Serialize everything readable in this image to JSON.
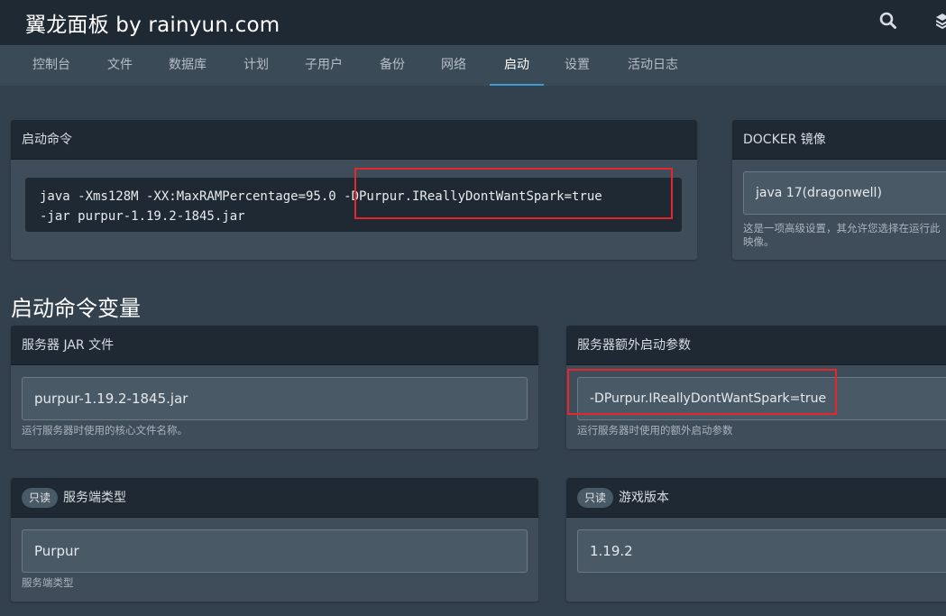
{
  "header": {
    "title": "翼龙面板 by rainyun.com"
  },
  "nav": {
    "tabs": [
      {
        "label": "控制台"
      },
      {
        "label": "文件"
      },
      {
        "label": "数据库"
      },
      {
        "label": "计划"
      },
      {
        "label": "子用户"
      },
      {
        "label": "备份"
      },
      {
        "label": "网络"
      },
      {
        "label": "启动"
      },
      {
        "label": "设置"
      },
      {
        "label": "活动日志"
      }
    ],
    "active": "启动"
  },
  "startup": {
    "title": "启动命令",
    "command_line1": "java -Xms128M -XX:MaxRAMPercentage=95.0 -DPurpur.IReallyDontWantSpark=true",
    "command_line2": "-jar purpur-1.19.2-1845.jar"
  },
  "docker": {
    "title": "DOCKER 镜像",
    "value": "java 17(dragonwell)",
    "help_line1": "这是一项高级设置，其允许您选择在运行此",
    "help_line2": "映像。"
  },
  "variables_title": "启动命令变量",
  "variables": {
    "jar": {
      "title": "服务器 JAR 文件",
      "value": "purpur-1.19.2-1845.jar",
      "help": "运行服务器时使用的核心文件名称。"
    },
    "extra": {
      "title": "服务器额外启动参数",
      "value": "-DPurpur.IReallyDontWantSpark=true",
      "help": "运行服务器时使用的额外启动参数"
    },
    "server_type": {
      "badge": "只读",
      "title": "服务端类型",
      "value": "Purpur",
      "help": "服务端类型"
    },
    "game_version": {
      "badge": "只读",
      "title": "游戏版本",
      "value": "1.19.2"
    }
  },
  "colors": {
    "background": "#33404d",
    "header": "#1f2933",
    "accent": "#3b9bd2",
    "highlight": "#e5262b"
  },
  "icons": {
    "search": "search-icon",
    "layers": "layers-icon"
  }
}
